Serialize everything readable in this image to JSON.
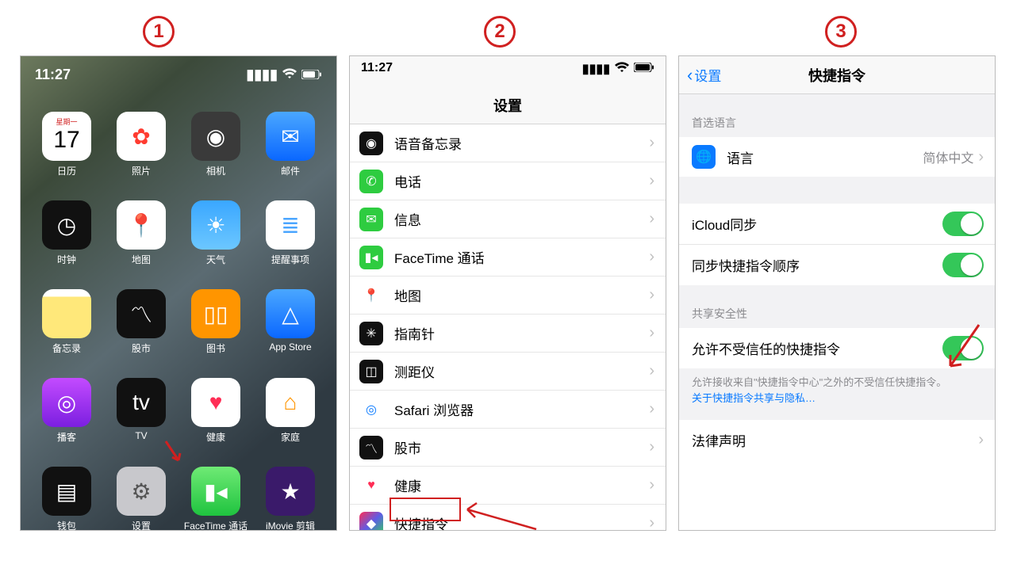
{
  "steps": {
    "s1": "1",
    "s2": "2",
    "s3": "3"
  },
  "status": {
    "time": "11:27"
  },
  "home": {
    "apps": [
      {
        "id": "calendar",
        "label": "日历",
        "bg": "#ffffff",
        "glyph": "17",
        "glyph_top": "星期一",
        "fg": "#000"
      },
      {
        "id": "photos",
        "label": "照片",
        "bg": "#ffffff",
        "glyph": "✿",
        "fg": "#ff3b30"
      },
      {
        "id": "camera",
        "label": "相机",
        "bg": "#3a3a3a",
        "glyph": "◉"
      },
      {
        "id": "mail",
        "label": "邮件",
        "bg": "linear-gradient(#4aa7ff,#0a67ff)",
        "glyph": "✉"
      },
      {
        "id": "clock",
        "label": "时钟",
        "bg": "#111",
        "glyph": "◷"
      },
      {
        "id": "maps",
        "label": "地图",
        "bg": "#ffffff",
        "glyph": "📍",
        "fg": "#0b76db"
      },
      {
        "id": "weather",
        "label": "天气",
        "bg": "linear-gradient(#3aa7ff,#6cc7ff)",
        "glyph": "☀"
      },
      {
        "id": "reminders",
        "label": "提醒事项",
        "bg": "#ffffff",
        "glyph": "≣",
        "fg": "#4aa5ff"
      },
      {
        "id": "notes",
        "label": "备忘录",
        "bg": "linear-gradient(#fff 15%,#fff 15%,#ffe87a 0)",
        "glyph": "",
        "fg": "#c9b24b"
      },
      {
        "id": "stocks",
        "label": "股市",
        "bg": "#111",
        "glyph": "〽"
      },
      {
        "id": "books",
        "label": "图书",
        "bg": "#ff9500",
        "glyph": "▯▯"
      },
      {
        "id": "appstore",
        "label": "App Store",
        "bg": "linear-gradient(#4aa7ff,#0a67ff)",
        "glyph": "△"
      },
      {
        "id": "podcasts",
        "label": "播客",
        "bg": "linear-gradient(#c34bff,#7b1fe0)",
        "glyph": "◎"
      },
      {
        "id": "tv",
        "label": "TV",
        "bg": "#111",
        "glyph": "tv"
      },
      {
        "id": "health",
        "label": "健康",
        "bg": "#ffffff",
        "glyph": "♥",
        "fg": "#ff2d55"
      },
      {
        "id": "home",
        "label": "家庭",
        "bg": "#ffffff",
        "glyph": "⌂",
        "fg": "#ff9500"
      },
      {
        "id": "wallet",
        "label": "钱包",
        "bg": "#111",
        "glyph": "▤"
      },
      {
        "id": "settings",
        "label": "设置",
        "bg": "#c8c8cc",
        "glyph": "⚙",
        "fg": "#555"
      },
      {
        "id": "facetime",
        "label": "FaceTime 通话",
        "bg": "linear-gradient(#6fea75,#1fc33f)",
        "glyph": "▮◂"
      },
      {
        "id": "imovie",
        "label": "iMovie 剪辑",
        "bg": "#3a1a6a",
        "glyph": "★"
      }
    ]
  },
  "settings": {
    "title": "设置",
    "items": [
      {
        "id": "voice-memos",
        "label": "语音备忘录",
        "bg": "#111",
        "glyph": "◉"
      },
      {
        "id": "phone",
        "label": "电话",
        "bg": "#2ecc40",
        "glyph": "✆"
      },
      {
        "id": "messages",
        "label": "信息",
        "bg": "#2ecc40",
        "glyph": "✉"
      },
      {
        "id": "facetime",
        "label": "FaceTime 通话",
        "bg": "#2ecc40",
        "glyph": "▮◂"
      },
      {
        "id": "maps",
        "label": "地图",
        "bg": "#fff",
        "glyph": "📍",
        "fg": "#0b76db"
      },
      {
        "id": "compass",
        "label": "指南针",
        "bg": "#111",
        "glyph": "✳"
      },
      {
        "id": "measure",
        "label": "测距仪",
        "bg": "#111",
        "glyph": "◫"
      },
      {
        "id": "safari",
        "label": "Safari 浏览器",
        "bg": "#fff",
        "glyph": "◎",
        "fg": "#0a7aff"
      },
      {
        "id": "stocks",
        "label": "股市",
        "bg": "#111",
        "glyph": "〽"
      },
      {
        "id": "health",
        "label": "健康",
        "bg": "#fff",
        "glyph": "♥",
        "fg": "#ff2d55"
      },
      {
        "id": "shortcuts",
        "label": "快捷指令",
        "bg": "linear-gradient(135deg,#ff2d55,#5e5ce6,#30d158)",
        "glyph": "◆"
      }
    ]
  },
  "shortcuts": {
    "back": "设置",
    "title": "快捷指令",
    "section_lang": "首选语言",
    "language_label": "语言",
    "language_value": "简体中文",
    "icloud_sync": "iCloud同步",
    "sync_order": "同步快捷指令顺序",
    "section_sec": "共享安全性",
    "allow_untrusted": "允许不受信任的快捷指令",
    "note_text": "允许接收来自\"快捷指令中心\"之外的不受信任快捷指令。",
    "note_link": "关于快捷指令共享与隐私…",
    "legal": "法律声明"
  }
}
